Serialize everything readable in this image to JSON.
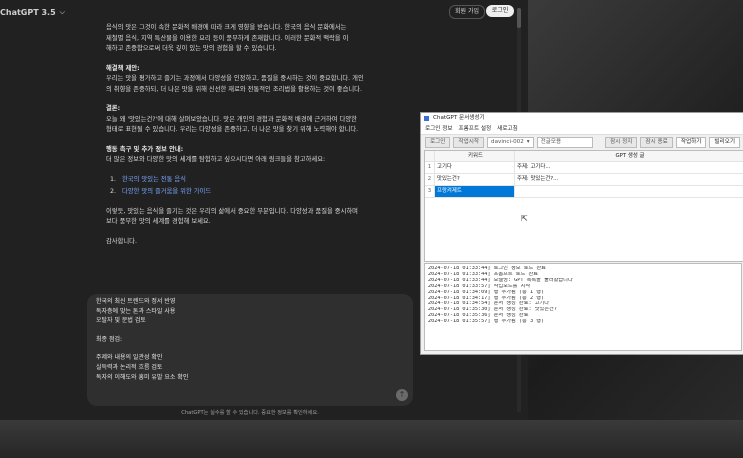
{
  "header": {
    "model": "ChatGPT 3.5",
    "signup": "회원 가입",
    "login": "로그인"
  },
  "chat": {
    "intro": [
      "음식의 맛은 그것이 속한 문화적 배경에 따라 크게 영향을 받습니다. 한국의 음식 문화에서는",
      "제철별 음식, 지역 특산물을 이용한 요리 등이 풍부하게 존재합니다. 이러한 문화적 맥락을 이",
      "해하고 존중함으로써 더욱 깊이 있는 맛의 경험을 할 수 있습니다."
    ],
    "suggest_title": "해결책 제안:",
    "suggest": [
      "우리는 맛을 평가하고 즐기는 과정에서 다양성을 인정하고, 품질을 중시하는 것이 중요합니다. 개인",
      "의 취향을 존중하되, 더 나은 맛을 위해 신선한 재료와 전통적인 조리법을 활용하는 것이 좋습니다."
    ],
    "conclusion_title": "결론:",
    "conclusion": [
      "오늘 왜 '맛있는건?'에 대해 살펴보았습니다. 맛은 개인의 경험과 문화적 배경에 근거하여 다양한",
      "형태로 표현될 수 있습니다. 우리는 다양성을 존중하고, 더 나은 맛을 찾기 위해 노력해야 합니다."
    ],
    "cta_title": "행동 촉구 및 추가 정보 안내:",
    "cta": "더 많은 정보와 다양한 맛의 세계를 탐험하고 싶으시다면 아래 링크들을 참고하세요:",
    "links": [
      {
        "num": "1.",
        "label": "한국의 맛있는 전통 음식"
      },
      {
        "num": "2.",
        "label": "다양한 맛의 즐거움을 위한 가이드"
      }
    ],
    "closing": [
      "이렇듯, 맛있는 음식을 즐기는 것은 우리의 삶에서 중요한 부분입니다. 다양성과 품질을 중시하며",
      "보다 풍부한 맛의 세계를 경험해 보세요."
    ],
    "thanks": "감사합니다."
  },
  "composer": {
    "lines": [
      "한국의 최신 트렌드와 정서 반영",
      "독자층에 맞는 톤과 스타일 사용",
      "오탈자 및 문법 검토"
    ],
    "final_title": "최종 점검:",
    "final_lines": [
      "주제와 내용의 일관성 확인",
      "실득력과 논리적 흐름 검토",
      "독자의 이해도와 흥미 유발 요소 확인"
    ],
    "send_icon": "arrow-up-icon"
  },
  "disclaimer": "ChatGPT는 실수를 할 수 있습니다. 중요한 정보를 확인하세요.",
  "app": {
    "title": "ChatGPT 문서생성기",
    "menus": [
      "로그인 정보",
      "프롬프트 설정",
      "새로고침"
    ],
    "toolbar": {
      "login": "로그인",
      "start": "작업시작",
      "model": "davinci-002",
      "edit": "전글모용",
      "stop": "잠시 정지",
      "restart": "잠시 종료",
      "collect": "작업하기",
      "clear": "빌리오기"
    },
    "grid": {
      "col_keyword": "키워드",
      "col_result": "GPT 생성 글",
      "rows": [
        {
          "idx": "1",
          "keyword": "고기다",
          "result": "주제: 고기다..."
        },
        {
          "idx": "2",
          "keyword": "맛있는건?",
          "result": "주제: 맛있는건?..."
        },
        {
          "idx": "3",
          "keyword": "프랑켜제트",
          "result": ""
        }
      ]
    },
    "log": [
      "2024-07-18 01:33:44] 로그인 정보 로드 완료",
      "2024-07-18 01:33:44] 프롬프트 로드 완료",
      "2024-07-18 01:33:44] 모델명: GPT 목록을 불러왔습니다",
      "2024-07-18 01:33:57] 작업모드를 시작",
      "2024-07-18 01:34:09] 행 추가됨 (총 1 행)",
      "2024-07-18 01:34:17] 행 추가됨 (총 2 행)",
      "2024-07-18 01:34:54] 문서 생성 완료: 고기다",
      "2024-07-18 01:35:30] 문서 생성 완료: 맛있는건?",
      "2024-07-18 01:35:36] 문서 생성 완료",
      "2024-07-18 01:35:57] 행 추가됨 (총 3 행)"
    ]
  }
}
